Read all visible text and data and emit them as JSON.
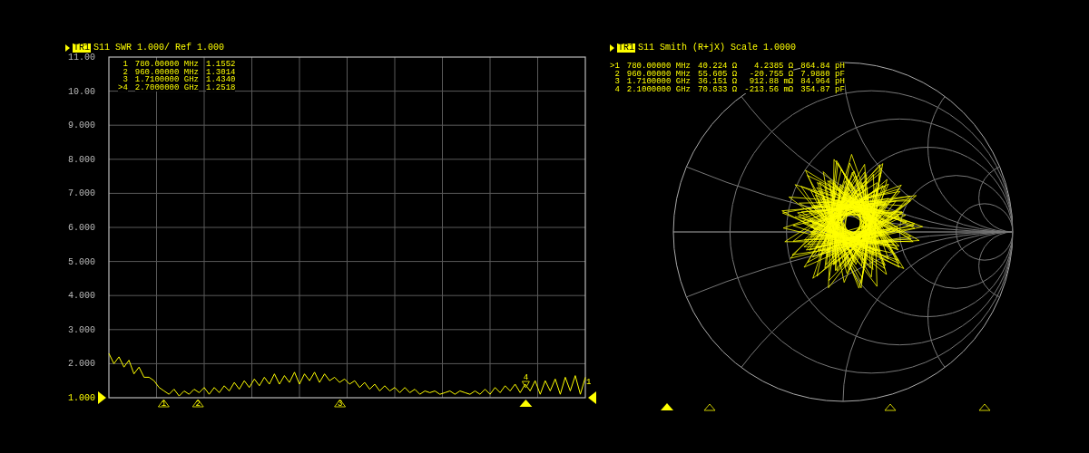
{
  "swr_panel": {
    "trace_badge": "TR1",
    "header": "S11 SWR 1.000/ Ref 1.000",
    "marker_table": [
      {
        "label": "1",
        "frequency": "780.00000 MHz",
        "value": "1.1552"
      },
      {
        "label": "2",
        "frequency": "960.00000 MHz",
        "value": "1.3014"
      },
      {
        "label": "3",
        "frequency": "1.7100000 GHz",
        "value": "1.4340"
      },
      {
        "label": ">4",
        "frequency": "2.7000000 GHz",
        "value": "1.2518"
      }
    ],
    "markers": [
      {
        "label": "1",
        "selected": false
      },
      {
        "label": "2",
        "selected": false
      },
      {
        "label": "3",
        "selected": false
      },
      {
        "label": "4",
        "selected": true
      }
    ],
    "trace_labels": [
      "1"
    ],
    "chart_data": {
      "type": "line",
      "grid": true,
      "ylim": [
        1,
        11
      ],
      "yticks": [
        {
          "value": 1,
          "label": "1.000"
        },
        {
          "value": 2,
          "label": "2.000"
        },
        {
          "value": 3,
          "label": "3.000"
        },
        {
          "value": 4,
          "label": "4.000"
        },
        {
          "value": 5,
          "label": "5.000"
        },
        {
          "value": 6,
          "label": "6.000"
        },
        {
          "value": 7,
          "label": "7.000"
        },
        {
          "value": 8,
          "label": "8.000"
        },
        {
          "value": 9,
          "label": "9.000"
        },
        {
          "value": 10,
          "label": "10.00"
        },
        {
          "value": 11,
          "label": "11.00"
        }
      ],
      "series": [
        {
          "color": "#ffff00",
          "values": [
            2.3,
            2.0,
            2.2,
            1.9,
            2.1,
            1.7,
            1.9,
            1.6,
            1.6,
            1.5,
            1.3,
            1.2,
            1.1,
            1.25,
            1.05,
            1.2,
            1.1,
            1.25,
            1.15,
            1.3,
            1.1,
            1.3,
            1.15,
            1.35,
            1.2,
            1.45,
            1.25,
            1.5,
            1.3,
            1.55,
            1.35,
            1.6,
            1.4,
            1.7,
            1.4,
            1.65,
            1.45,
            1.75,
            1.4,
            1.7,
            1.5,
            1.75,
            1.45,
            1.7,
            1.5,
            1.6,
            1.45,
            1.55,
            1.4,
            1.5,
            1.3,
            1.45,
            1.25,
            1.4,
            1.2,
            1.35,
            1.2,
            1.3,
            1.15,
            1.3,
            1.15,
            1.25,
            1.1,
            1.2,
            1.15,
            1.2,
            1.1,
            1.15,
            1.2,
            1.1,
            1.2,
            1.15,
            1.1,
            1.2,
            1.1,
            1.25,
            1.1,
            1.3,
            1.15,
            1.35,
            1.2,
            1.4,
            1.15,
            1.4,
            1.2,
            1.5,
            1.1,
            1.5,
            1.2,
            1.55,
            1.1,
            1.6,
            1.2,
            1.65,
            1.1,
            1.6
          ]
        }
      ]
    }
  },
  "smith_panel": {
    "trace_badge": "TR1",
    "header": "S11 Smith (R+jX) Scale 1.0000",
    "marker_table": [
      {
        "label": ">1",
        "frequency": "780.00000 MHz",
        "resistance": "40.224 Ω",
        "reactance": "4.2385 Ω",
        "equivalent": "864.84 pH"
      },
      {
        "label": "2",
        "frequency": "960.00000 MHz",
        "resistance": "55.605 Ω",
        "reactance": "-20.755 Ω",
        "equivalent": "7.9880 pF"
      },
      {
        "label": "3",
        "frequency": "1.7100000 GHz",
        "resistance": "36.151 Ω",
        "reactance": "912.88 mΩ",
        "equivalent": "84.964 pH"
      },
      {
        "label": "4",
        "frequency": "2.1000000 GHz",
        "resistance": "70.633 Ω",
        "reactance": "-213.56 mΩ",
        "equivalent": "354.87 pF"
      }
    ],
    "markers": [
      {
        "selected": true
      },
      {
        "selected": false
      },
      {
        "selected": false
      },
      {
        "selected": false
      }
    ]
  }
}
